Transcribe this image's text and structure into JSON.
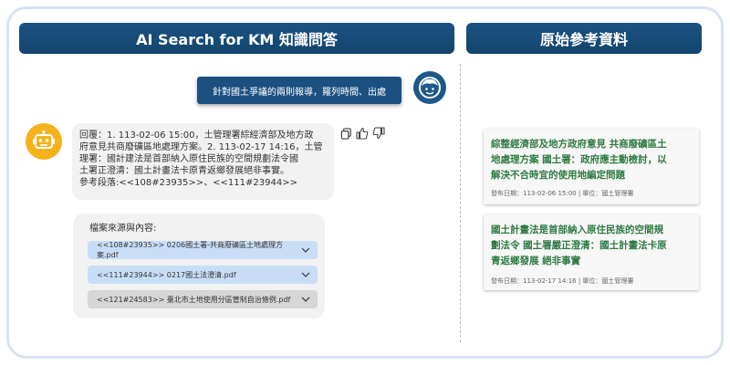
{
  "header": {
    "left_title": "AI Search for KM 知識問答",
    "right_title": "原始參考資料"
  },
  "chat": {
    "user_message": "針對國土爭議的兩則報導，羅列時間、出處",
    "answer_lines": [
      "回覆：1. 113-02-06 15:00，土管理署綜經濟部及地方政",
      "府意見共商廢礦區地處理方案。2. 113-02-17 14:16，土管",
      "理署：國計建法是首部納入原住民族的空間規劃法令國",
      "土署正澄清：國土計畫法卡原青返鄉發展絕非事實。",
      "參考段落:<<108#23935>>、<<111#23944>>"
    ],
    "sources_title": "檔案來源與內容:",
    "files": [
      {
        "label": "<<108#23935>> 0206國土署-共商廢礦區土地處理方案.pdf",
        "style": "blue"
      },
      {
        "label": "<<111#23944>> 0217國土法澄清.pdf",
        "style": "blue"
      },
      {
        "label": "<<121#24583>> 臺北市土地使用分區管制自治條例.pdf",
        "style": "grey"
      }
    ]
  },
  "references": [
    {
      "title_lines": [
        "綜整經濟部及地方政府意見 共商廢礦區土",
        "地處理方案 國土署：政府應主動檢討，以",
        "解決不合時宜的使用地編定問題"
      ],
      "meta": "發布日期：113-02-06 15:00 | 單位：國土管理署"
    },
    {
      "title_lines": [
        "國土計畫法是首部納入原住民族的空間規",
        "劃法令 國土署嚴正澄清：國土計畫法卡原",
        "青返鄉發展 絕非事實"
      ],
      "meta": "發布日期：113-02-17 14:16 | 單位：國土管理署"
    }
  ],
  "icons": {
    "user_avatar": "user-face-icon",
    "bot_avatar": "robot-icon",
    "copy": "copy-icon",
    "like": "thumbs-up-icon",
    "dislike": "thumbs-down-icon",
    "dropdown": "chevron-down-icon"
  },
  "colors": {
    "header_bg": "#14446e",
    "user_bubble": "#1c5080",
    "bot_avatar": "#f6b21b",
    "ref_title": "#2f7a43",
    "file_pill_blue": "#c8def7",
    "file_pill_grey": "#d6d6d6"
  }
}
